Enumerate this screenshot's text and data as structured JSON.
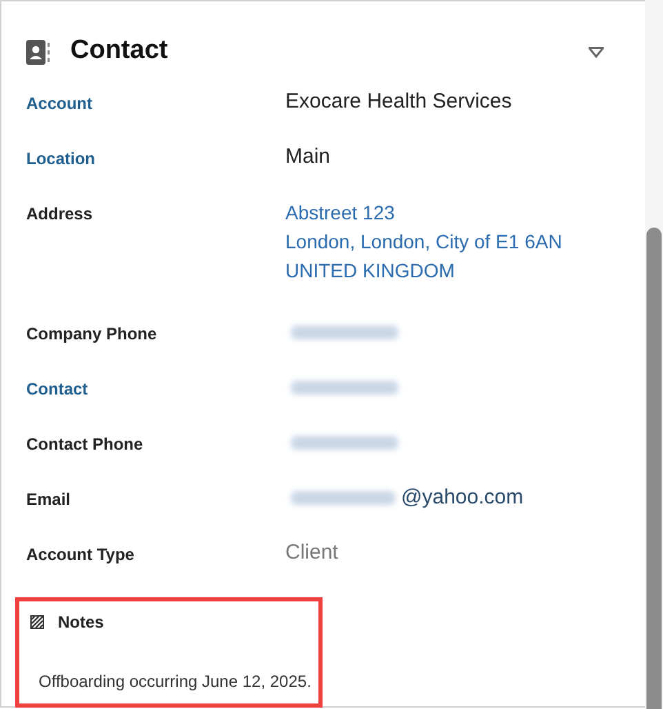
{
  "section": {
    "title": "Contact",
    "expanded": true
  },
  "fields": [
    {
      "label": "Account",
      "label_linked": true,
      "kind": "text",
      "lines": [
        "Exocare Health Services"
      ]
    },
    {
      "label": "Location",
      "label_linked": true,
      "kind": "text",
      "lines": [
        "Main"
      ]
    },
    {
      "label": "Address",
      "label_linked": false,
      "kind": "link",
      "lines": [
        "Abstreet 123",
        "London, London, City of E1 6AN",
        "UNITED KINGDOM"
      ]
    },
    {
      "label": "Company Phone",
      "label_linked": false,
      "kind": "redacted"
    },
    {
      "label": "Contact",
      "label_linked": true,
      "kind": "redacted"
    },
    {
      "label": "Contact Phone",
      "label_linked": false,
      "kind": "redacted"
    },
    {
      "label": "Email",
      "label_linked": false,
      "kind": "partly_redacted",
      "lines": [
        "@yahoo.com"
      ]
    },
    {
      "label": "Account Type",
      "label_linked": false,
      "kind": "muted",
      "lines": [
        "Client"
      ]
    }
  ],
  "notes": {
    "title": "Notes",
    "text": "Offboarding occurring June 12, 2025.",
    "highlighted": true
  }
}
